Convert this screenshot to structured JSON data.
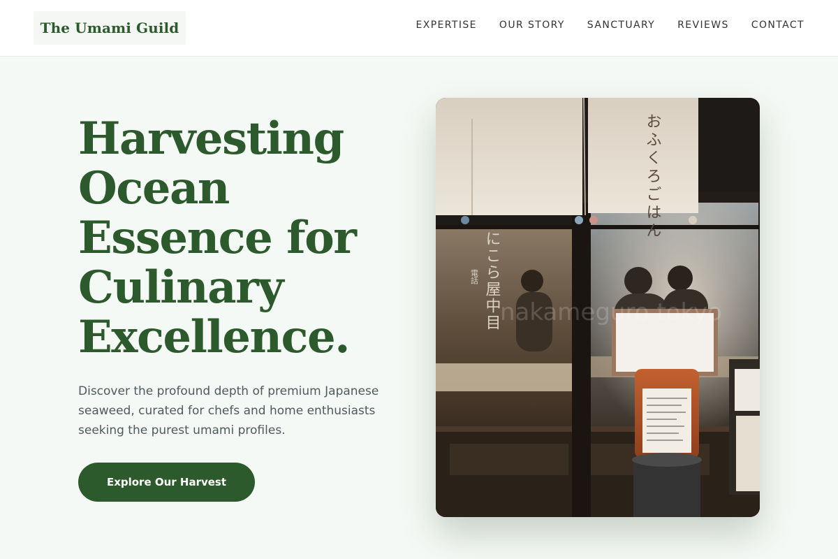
{
  "brand": {
    "name": "The Umami Guild"
  },
  "nav": {
    "items": [
      {
        "label": "EXPERTISE"
      },
      {
        "label": "OUR STORY"
      },
      {
        "label": "SANCTUARY"
      },
      {
        "label": "REVIEWS"
      },
      {
        "label": "CONTACT"
      }
    ]
  },
  "hero": {
    "title_lines": [
      "Harvesting",
      "Ocean",
      "Essence for",
      "Culinary",
      "Excellence."
    ],
    "description": "Discover the profound depth of premium Japanese seaweed, curated for chefs and home enthusiasts seeking the purest umami profiles.",
    "cta_label": "Explore Our Harvest"
  },
  "photo": {
    "noren_text": "おふくろごはん",
    "window_text": "にこら屋中目",
    "phone_text": "電話",
    "watermark": "nakameguro tokyo"
  },
  "colors": {
    "accent": "#2d5a2d",
    "page_background": "#f5f9f5",
    "header_background": "#ffffff",
    "body_text": "#4e5a5e",
    "nav_text": "#333333"
  }
}
